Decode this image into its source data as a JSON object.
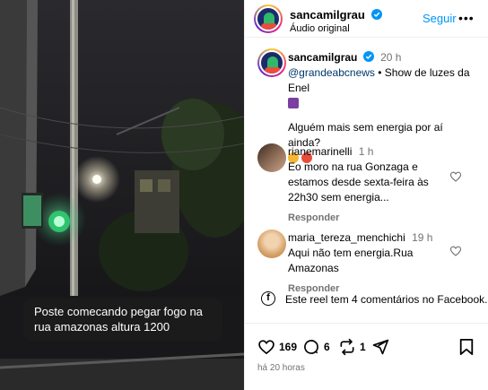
{
  "video": {
    "caption": "Poste comecando pegar fogo na rua amazonas altura 1200"
  },
  "header": {
    "username": "sancamilgrau",
    "subtitle": "Áudio original",
    "follow_label": "Seguir",
    "more_label": "•••"
  },
  "post": {
    "username": "sancamilgrau",
    "time": "20 h",
    "mention": "@grandeabcnews",
    "text": " • Show de luzes da Enel",
    "second_line": "Alguém mais sem energia por aí ainda?"
  },
  "comments": [
    {
      "username": "rianemarinelli",
      "time": "1 h",
      "text": "Eo moro na rua Gonzaga e estamos desde sexta-feira às 22h30 sem energia...",
      "reply_label": "Responder"
    },
    {
      "username": "maria_tereza_menchichi",
      "time": "19 h",
      "text": "Aqui não tem energia.Rua Amazonas",
      "reply_label": "Responder"
    }
  ],
  "facebook_note": "Este reel tem 4 comentários no Facebook.",
  "facebook_icon_glyph": "f",
  "actions": {
    "likes": "169",
    "comments": "6",
    "reposts": "1",
    "time_ago": "há 20 horas"
  },
  "colors": {
    "accent": "#0095f6",
    "link": "#00376b",
    "muted": "#737373",
    "verified": "#0095f6",
    "caption_bg": "#1c1c1c"
  },
  "icons": {
    "verified": "verified-badge-icon",
    "heart": "heart-icon",
    "comment": "comment-bubble-icon",
    "repost": "repost-icon",
    "share": "paper-plane-icon",
    "save": "bookmark-icon",
    "facebook": "facebook-icon",
    "more": "more-options-icon"
  }
}
